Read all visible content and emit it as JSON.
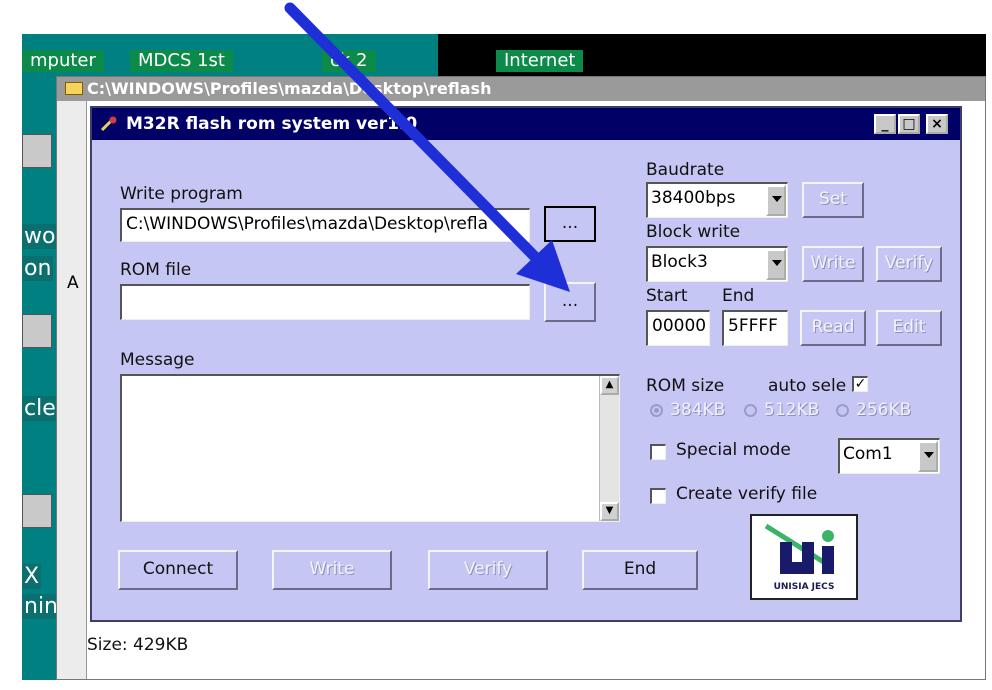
{
  "desktop": {
    "labels": [
      "mputer",
      "MDCS 1st",
      "ck 2",
      "Internet"
    ],
    "side_text": [
      "wo",
      "on",
      "cle",
      "X",
      "nin"
    ]
  },
  "explorer": {
    "title": "C:\\WINDOWS\\Profiles\\mazda\\Desktop\\reflash",
    "status_size": "Size: 429KB",
    "left_char": "A"
  },
  "dialog": {
    "title": "M32R flash rom system ver1.0",
    "titlebar_buttons": {
      "minimize": "_",
      "maximize": "□",
      "close": "×"
    },
    "write_program": {
      "label": "Write program",
      "value": "C:\\WINDOWS\\Profiles\\mazda\\Desktop\\refla",
      "browse": "..."
    },
    "rom_file": {
      "label": "ROM file",
      "value": "",
      "browse": "..."
    },
    "message": {
      "label": "Message"
    },
    "baudrate": {
      "label": "Baudrate",
      "value": "38400bps",
      "set": "Set"
    },
    "block_write": {
      "label": "Block write",
      "value": "Block3",
      "write": "Write",
      "verify": "Verify"
    },
    "range": {
      "start_label": "Start",
      "end_label": "End",
      "start_value": "00000",
      "end_value": "5FFFF",
      "read": "Read",
      "edit": "Edit"
    },
    "rom_size": {
      "label": "ROM size",
      "auto_label": "auto sele",
      "auto_checked": "✓",
      "options": [
        "384KB",
        "512KB",
        "256KB"
      ],
      "selected": "384KB"
    },
    "special_mode": {
      "label": "Special mode",
      "checked": false
    },
    "com_port": {
      "value": "Com1"
    },
    "create_verify": {
      "label": "Create verify file",
      "checked": false
    },
    "buttons": {
      "connect": "Connect",
      "write": "Write",
      "verify": "Verify",
      "end": "End"
    },
    "logo": {
      "text": "UNISIA JECS"
    }
  },
  "colors": {
    "dialog_bg": "#c5c6f3",
    "titlebar": "#000066",
    "desktop": "#008080",
    "annotation_arrow": "#1f2fd8"
  }
}
